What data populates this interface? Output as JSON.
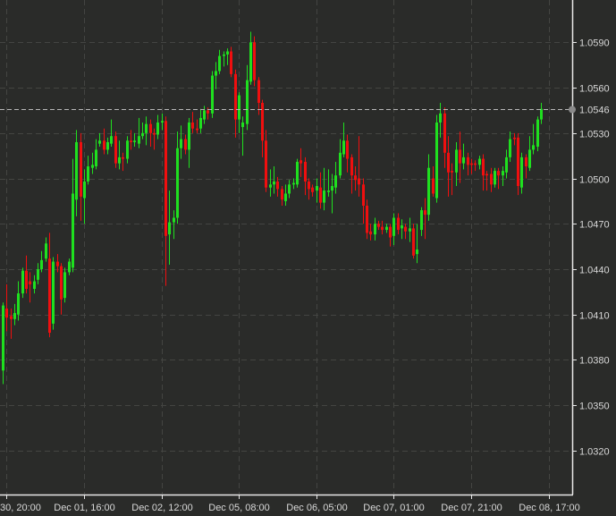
{
  "chart_data": {
    "type": "candlestick",
    "title": "",
    "xlabel": "",
    "ylabel": "",
    "ylim": [
      1.0291,
      1.0618
    ],
    "grid": true,
    "y_ticks": [
      "1.0590",
      "1.0560",
      "1.0530",
      "1.0500",
      "1.0470",
      "1.0440",
      "1.0410",
      "1.0380",
      "1.0350",
      "1.0320"
    ],
    "current_price": "1.0546",
    "x_ticks": [
      {
        "index": 1,
        "label": "30, 20:00"
      },
      {
        "index": 21,
        "label": "Dec 01, 16:00"
      },
      {
        "index": 41,
        "label": "Dec 02, 12:00"
      },
      {
        "index": 61,
        "label": "Dec 05, 08:00"
      },
      {
        "index": 81,
        "label": "Dec 06, 05:00"
      },
      {
        "index": 101,
        "label": "Dec 07, 01:00"
      },
      {
        "index": 121,
        "label": "Dec 07, 21:00"
      },
      {
        "index": 141,
        "label": "Dec 08, 17:00"
      }
    ],
    "colors": {
      "up": "#1fe01f",
      "down": "#f00f0f",
      "background": "#2a2b29",
      "grid": "#444542",
      "axis": "#e8e8e8"
    },
    "ohlc_fields": [
      "open",
      "high",
      "low",
      "close"
    ],
    "ohlc": [
      [
        1.0373,
        1.0418,
        1.0364,
        1.0416
      ],
      [
        1.0414,
        1.043,
        1.0399,
        1.0408
      ],
      [
        1.0409,
        1.0414,
        1.0394,
        1.0407
      ],
      [
        1.0407,
        1.0417,
        1.0403,
        1.0411
      ],
      [
        1.041,
        1.0432,
        1.0406,
        1.0424
      ],
      [
        1.0424,
        1.0441,
        1.0421,
        1.0439
      ],
      [
        1.0439,
        1.0449,
        1.0424,
        1.0427
      ],
      [
        1.0432,
        1.0438,
        1.0418,
        1.043
      ],
      [
        1.0427,
        1.0436,
        1.0424,
        1.0432
      ],
      [
        1.0433,
        1.0444,
        1.043,
        1.044
      ],
      [
        1.044,
        1.0452,
        1.0438,
        1.0446
      ],
      [
        1.0447,
        1.0461,
        1.0445,
        1.0457
      ],
      [
        1.0447,
        1.0464,
        1.0395,
        1.0398
      ],
      [
        1.0404,
        1.0448,
        1.04,
        1.0445
      ],
      [
        1.0445,
        1.045,
        1.0438,
        1.0442
      ],
      [
        1.0442,
        1.0444,
        1.041,
        1.042
      ],
      [
        1.0421,
        1.0441,
        1.0418,
        1.0438
      ],
      [
        1.0438,
        1.0447,
        1.0436,
        1.0445
      ],
      [
        1.0441,
        1.0513,
        1.0438,
        1.049
      ],
      [
        1.0486,
        1.0532,
        1.0475,
        1.0524
      ],
      [
        1.0524,
        1.053,
        1.0472,
        1.0488
      ],
      [
        1.0487,
        1.0506,
        1.047,
        1.0498
      ],
      [
        1.0498,
        1.0515,
        1.0496,
        1.0508
      ],
      [
        1.0507,
        1.0517,
        1.0503,
        1.0509
      ],
      [
        1.0508,
        1.0526,
        1.0506,
        1.0519
      ],
      [
        1.0523,
        1.053,
        1.0521,
        1.0525
      ],
      [
        1.0525,
        1.0533,
        1.0516,
        1.0519
      ],
      [
        1.0519,
        1.0527,
        1.0516,
        1.0524
      ],
      [
        1.0523,
        1.0539,
        1.0521,
        1.0528
      ],
      [
        1.0528,
        1.0531,
        1.0507,
        1.051
      ],
      [
        1.051,
        1.0525,
        1.0506,
        1.0514
      ],
      [
        1.0514,
        1.0517,
        1.0505,
        1.0513
      ],
      [
        1.0513,
        1.0528,
        1.051,
        1.0525
      ],
      [
        1.0525,
        1.0532,
        1.0519,
        1.0524
      ],
      [
        1.0524,
        1.053,
        1.0521,
        1.0525
      ],
      [
        1.0523,
        1.054,
        1.052,
        1.0528
      ],
      [
        1.0528,
        1.0537,
        1.0526,
        1.053
      ],
      [
        1.053,
        1.0541,
        1.0522,
        1.0536
      ],
      [
        1.0536,
        1.0539,
        1.0521,
        1.053
      ],
      [
        1.053,
        1.0533,
        1.0519,
        1.0529
      ],
      [
        1.0529,
        1.0542,
        1.0526,
        1.0537
      ],
      [
        1.0537,
        1.0543,
        1.0532,
        1.0538
      ],
      [
        1.0538,
        1.0541,
        1.0429,
        1.0462
      ],
      [
        1.0463,
        1.0492,
        1.0443,
        1.0471
      ],
      [
        1.0471,
        1.0479,
        1.046,
        1.0474
      ],
      [
        1.0474,
        1.0531,
        1.047,
        1.052
      ],
      [
        1.052,
        1.0535,
        1.0513,
        1.0526
      ],
      [
        1.0526,
        1.0529,
        1.0516,
        1.0519
      ],
      [
        1.0519,
        1.054,
        1.0507,
        1.0537
      ],
      [
        1.0537,
        1.0544,
        1.053,
        1.0533
      ],
      [
        1.0533,
        1.0539,
        1.053,
        1.0532
      ],
      [
        1.0533,
        1.0546,
        1.053,
        1.054
      ],
      [
        1.0539,
        1.0548,
        1.0536,
        1.0545
      ],
      [
        1.0545,
        1.0547,
        1.0539,
        1.0543
      ],
      [
        1.0543,
        1.0571,
        1.054,
        1.0568
      ],
      [
        1.0568,
        1.0577,
        1.0559,
        1.0571
      ],
      [
        1.0571,
        1.0585,
        1.0569,
        1.0581
      ],
      [
        1.0581,
        1.0584,
        1.0574,
        1.0582
      ],
      [
        1.0582,
        1.0586,
        1.0575,
        1.0584
      ],
      [
        1.0584,
        1.0587,
        1.0567,
        1.0569
      ],
      [
        1.0569,
        1.0572,
        1.0527,
        1.0539
      ],
      [
        1.0539,
        1.0557,
        1.053,
        1.0555
      ],
      [
        1.0534,
        1.0541,
        1.0515,
        1.0537
      ],
      [
        1.0536,
        1.0575,
        1.0532,
        1.0565
      ],
      [
        1.0564,
        1.0597,
        1.0562,
        1.059
      ],
      [
        1.059,
        1.0594,
        1.0561,
        1.0565
      ],
      [
        1.0565,
        1.0567,
        1.0542,
        1.055
      ],
      [
        1.055,
        1.0552,
        1.0514,
        1.0525
      ],
      [
        1.0525,
        1.0532,
        1.0491,
        1.0494
      ],
      [
        1.0494,
        1.0506,
        1.0488,
        1.0496
      ],
      [
        1.0496,
        1.0508,
        1.049,
        1.0498
      ],
      [
        1.0498,
        1.0501,
        1.0488,
        1.0493
      ],
      [
        1.0493,
        1.0495,
        1.0482,
        1.0486
      ],
      [
        1.0485,
        1.0496,
        1.0482,
        1.049
      ],
      [
        1.049,
        1.0499,
        1.0487,
        1.0496
      ],
      [
        1.0496,
        1.05,
        1.0493,
        1.0497
      ],
      [
        1.0496,
        1.0513,
        1.0494,
        1.0511
      ],
      [
        1.0512,
        1.052,
        1.0501,
        1.051
      ],
      [
        1.0511,
        1.0514,
        1.0489,
        1.0498
      ],
      [
        1.0498,
        1.05,
        1.0486,
        1.0493
      ],
      [
        1.0494,
        1.0496,
        1.0488,
        1.0491
      ],
      [
        1.0492,
        1.05,
        1.0484,
        1.0495
      ],
      [
        1.0494,
        1.0504,
        1.048,
        1.0484
      ],
      [
        1.0484,
        1.0507,
        1.0479,
        1.0492
      ],
      [
        1.0491,
        1.0506,
        1.0488,
        1.0492
      ],
      [
        1.0492,
        1.0503,
        1.0477,
        1.0495
      ],
      [
        1.0494,
        1.0511,
        1.049,
        1.0502
      ],
      [
        1.0502,
        1.0526,
        1.05,
        1.0517
      ],
      [
        1.0516,
        1.0537,
        1.0514,
        1.0525
      ],
      [
        1.0525,
        1.0529,
        1.0504,
        1.0513
      ],
      [
        1.0514,
        1.0516,
        1.049,
        1.0502
      ],
      [
        1.0502,
        1.0508,
        1.0492,
        1.0499
      ],
      [
        1.05,
        1.0528,
        1.0488,
        1.0496
      ],
      [
        1.0496,
        1.05,
        1.047,
        1.0482
      ],
      [
        1.0482,
        1.0486,
        1.046,
        1.0464
      ],
      [
        1.0465,
        1.047,
        1.0459,
        1.0463
      ],
      [
        1.0463,
        1.0474,
        1.0459,
        1.047
      ],
      [
        1.047,
        1.0472,
        1.0466,
        1.0468
      ],
      [
        1.0468,
        1.0472,
        1.0463,
        1.0466
      ],
      [
        1.0466,
        1.047,
        1.0464,
        1.0468
      ],
      [
        1.0468,
        1.047,
        1.0455,
        1.0461
      ],
      [
        1.0462,
        1.0477,
        1.0456,
        1.0474
      ],
      [
        1.0474,
        1.0477,
        1.0463,
        1.0466
      ],
      [
        1.0467,
        1.0473,
        1.046,
        1.0469
      ],
      [
        1.0468,
        1.047,
        1.046,
        1.0465
      ],
      [
        1.0465,
        1.0474,
        1.0458,
        1.0467
      ],
      [
        1.0467,
        1.047,
        1.0447,
        1.0449
      ],
      [
        1.045,
        1.047,
        1.0444,
        1.0453
      ],
      [
        1.0466,
        1.0481,
        1.0462,
        1.0479
      ],
      [
        1.0479,
        1.0487,
        1.046,
        1.0476
      ],
      [
        1.0476,
        1.0516,
        1.0472,
        1.0507
      ],
      [
        1.05,
        1.0508,
        1.0488,
        1.049
      ],
      [
        1.0487,
        1.0542,
        1.0484,
        1.0537
      ],
      [
        1.0537,
        1.055,
        1.0527,
        1.0543
      ],
      [
        1.0543,
        1.0547,
        1.0507,
        1.0517
      ],
      [
        1.0517,
        1.0528,
        1.0488,
        1.0504
      ],
      [
        1.0505,
        1.051,
        1.0489,
        1.0504
      ],
      [
        1.0504,
        1.0524,
        1.0495,
        1.0519
      ],
      [
        1.0519,
        1.0531,
        1.0497,
        1.051
      ],
      [
        1.051,
        1.0523,
        1.0506,
        1.0514
      ],
      [
        1.0514,
        1.0517,
        1.0502,
        1.0509
      ],
      [
        1.051,
        1.0513,
        1.0503,
        1.0509
      ],
      [
        1.051,
        1.0512,
        1.0505,
        1.0509
      ],
      [
        1.0509,
        1.0515,
        1.0506,
        1.0513
      ],
      [
        1.0513,
        1.0516,
        1.0492,
        1.0502
      ],
      [
        1.0503,
        1.0505,
        1.0492,
        1.0502
      ],
      [
        1.0503,
        1.0507,
        1.0491,
        1.0496
      ],
      [
        1.0496,
        1.0507,
        1.0494,
        1.0505
      ],
      [
        1.0505,
        1.0507,
        1.0493,
        1.0502
      ],
      [
        1.0502,
        1.0508,
        1.0495,
        1.0505
      ],
      [
        1.0504,
        1.0519,
        1.05,
        1.0514
      ],
      [
        1.0514,
        1.0531,
        1.0511,
        1.0526
      ],
      [
        1.0527,
        1.053,
        1.0522,
        1.0526
      ],
      [
        1.0527,
        1.053,
        1.0489,
        1.0495
      ],
      [
        1.0494,
        1.0517,
        1.049,
        1.0514
      ],
      [
        1.0514,
        1.0516,
        1.05,
        1.0508
      ],
      [
        1.0507,
        1.0528,
        1.0505,
        1.0519
      ],
      [
        1.0519,
        1.0536,
        1.0516,
        1.0522
      ],
      [
        1.0521,
        1.0541,
        1.0518,
        1.0539
      ],
      [
        1.0539,
        1.055,
        1.0536,
        1.0546
      ]
    ]
  }
}
